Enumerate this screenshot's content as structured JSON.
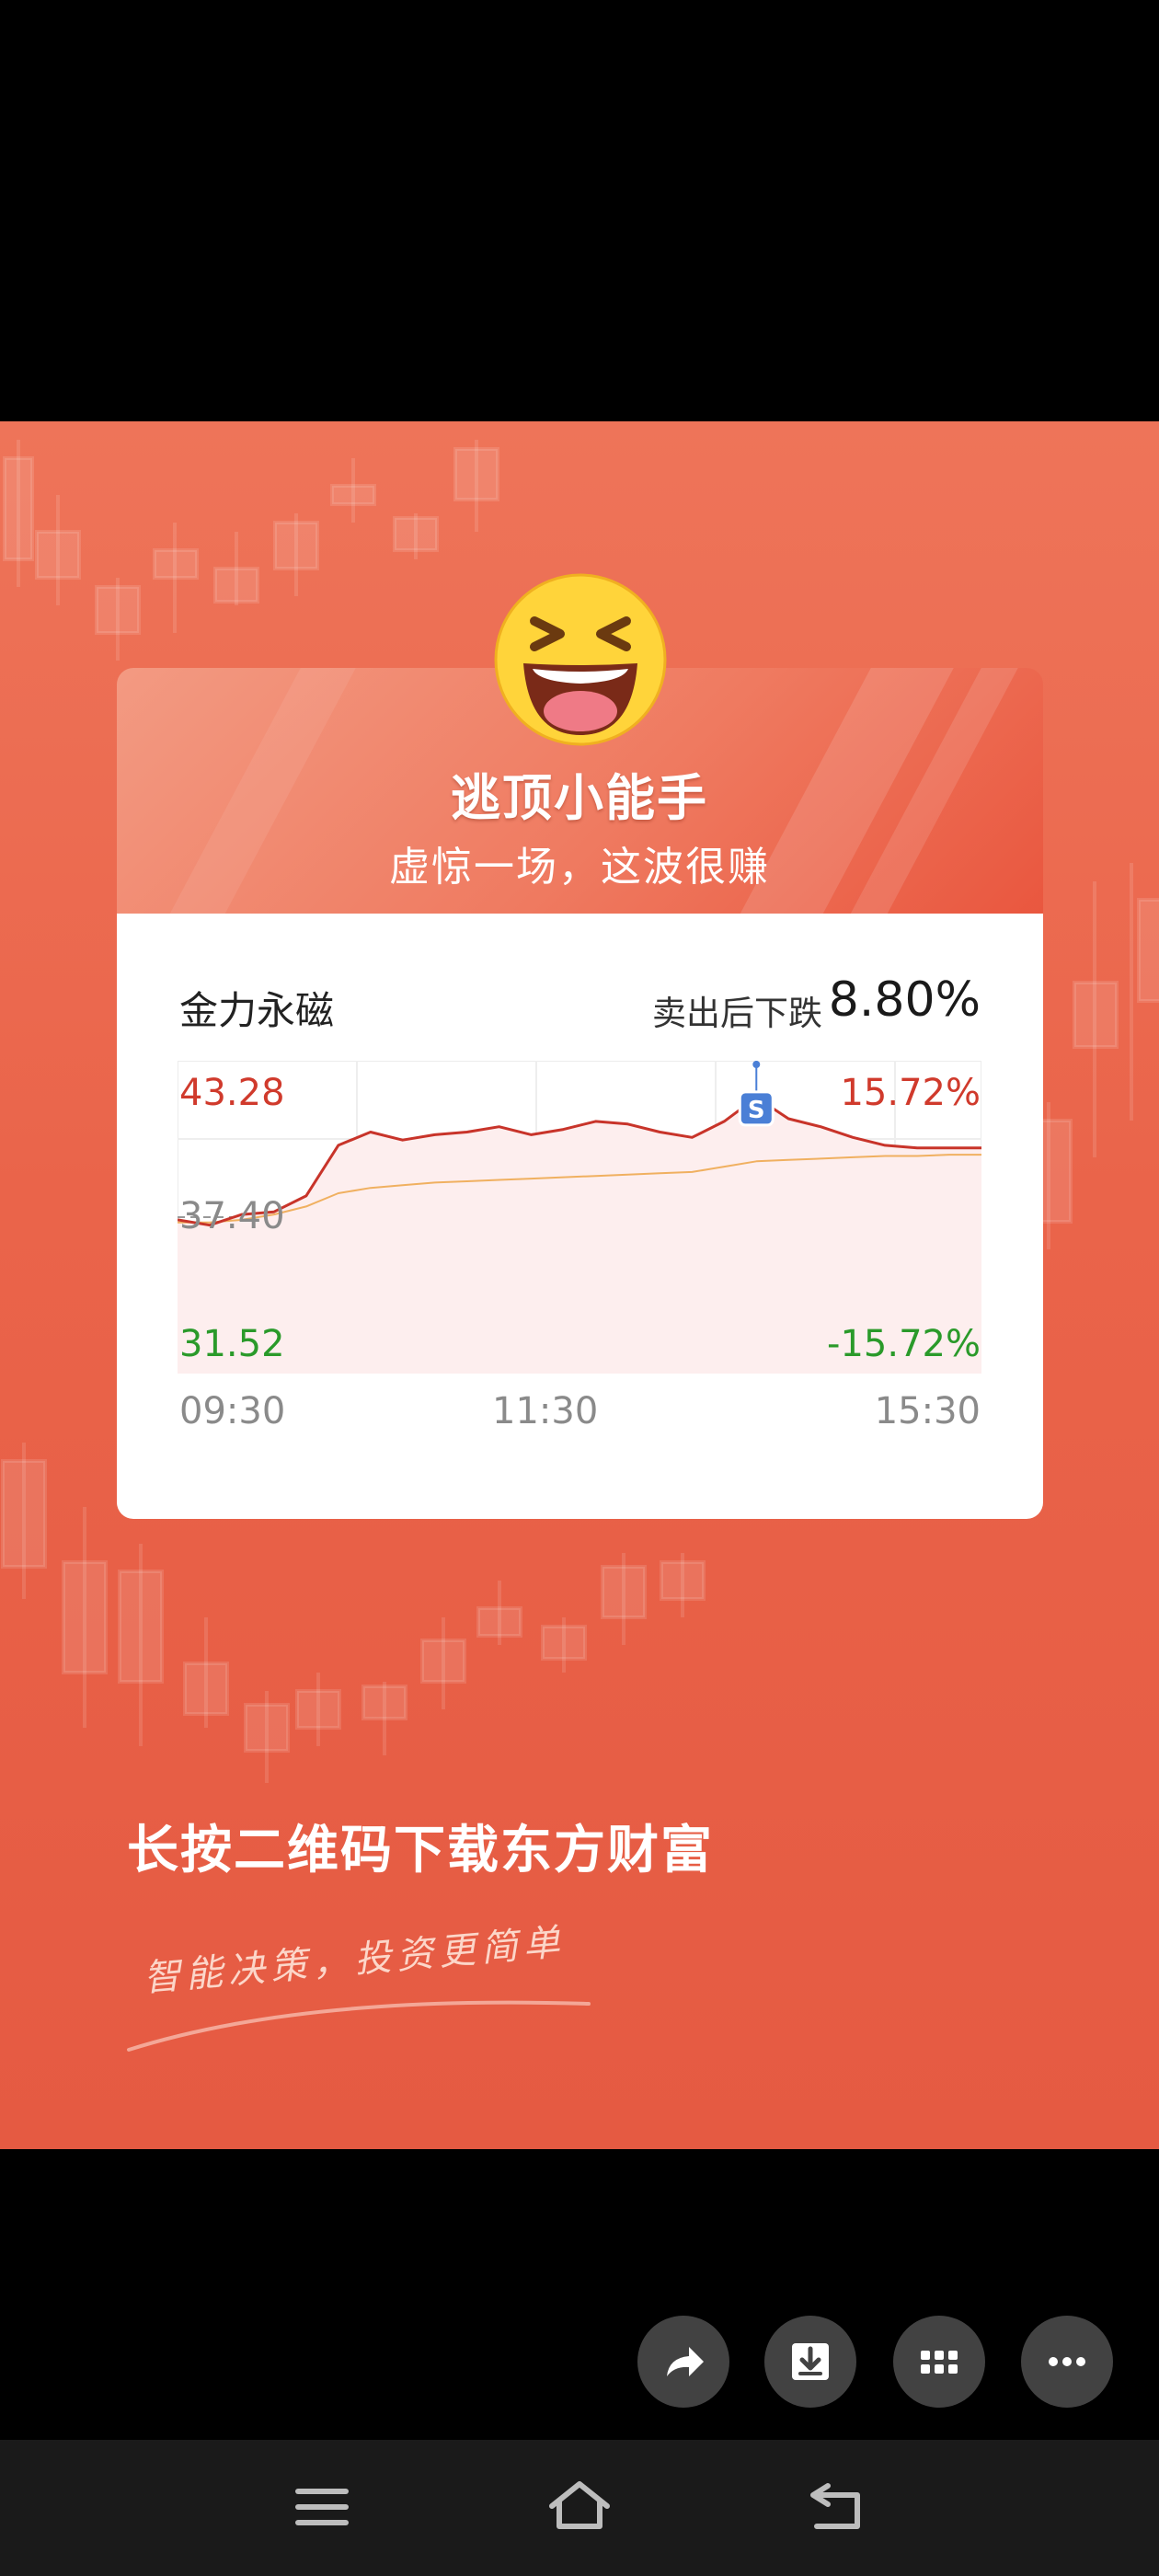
{
  "poster": {
    "title": "逃顶小能手",
    "subtitle": "虚惊一场，这波很赚"
  },
  "stock": {
    "name": "金力永磁",
    "drop_label": "卖出后下跌",
    "drop_value": "8.80%"
  },
  "chart_data": {
    "type": "line",
    "y_high": "43.28",
    "y_mid": "37.40",
    "y_low": "31.52",
    "pct_high": "15.72%",
    "pct_low": "-15.72%",
    "x_ticks": [
      "09:30",
      "11:30",
      "15:30"
    ],
    "sell_marker": "S",
    "ylim": [
      31.52,
      43.28
    ],
    "x": [
      "09:30",
      "09:40",
      "09:50",
      "10:00",
      "10:10",
      "10:20",
      "10:30",
      "10:40",
      "10:50",
      "11:00",
      "11:10",
      "11:20",
      "11:30",
      "13:10",
      "13:20",
      "13:30",
      "13:40",
      "13:50",
      "14:00",
      "14:10",
      "14:20",
      "14:30",
      "14:40",
      "14:50",
      "15:00",
      "15:30"
    ],
    "series": [
      {
        "values": [
          37.3,
          37.1,
          37.5,
          37.6,
          38.2,
          40.1,
          40.6,
          40.3,
          40.5,
          40.6,
          40.8,
          40.5,
          40.7,
          41.0,
          40.9,
          40.6,
          40.4,
          41.0,
          41.9,
          41.1,
          40.8,
          40.4,
          40.1,
          40.0,
          40.0,
          40.0
        ]
      },
      {
        "values": [
          37.2,
          37.2,
          37.3,
          37.5,
          37.8,
          38.3,
          38.5,
          38.6,
          38.7,
          38.75,
          38.8,
          38.85,
          38.9,
          38.95,
          39.0,
          39.05,
          39.1,
          39.3,
          39.5,
          39.55,
          39.6,
          39.65,
          39.7,
          39.7,
          39.75,
          39.75
        ]
      }
    ],
    "colors": {
      "price": "#c8342a",
      "avg": "#f0b060",
      "fill": "#fdeeee"
    }
  },
  "footer": {
    "cta": "长按二维码下载东方财富",
    "slogan": "智能决策，投资更简单"
  },
  "actions": [
    "share-icon",
    "download-icon",
    "grid-icon",
    "more-icon"
  ],
  "navbar": [
    "menu-icon",
    "home-icon",
    "back-icon"
  ]
}
